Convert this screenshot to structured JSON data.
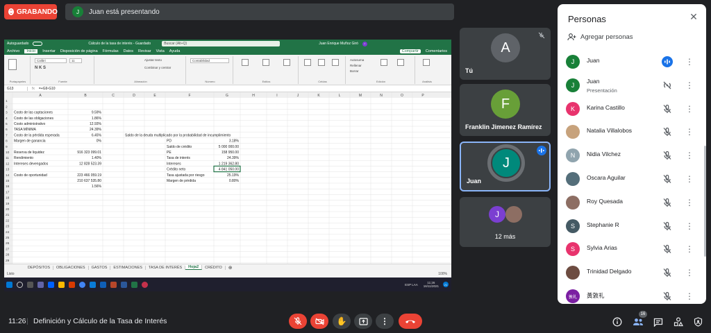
{
  "recording": {
    "label": "GRABANDO"
  },
  "presenting": {
    "initial": "J",
    "text": "Juan está presentando",
    "color": "#188038"
  },
  "excel": {
    "autosave": "Autoguardado",
    "doc_title": "Cálculo de la tasa de interés - Guardado",
    "search_placeholder": "Buscar (Alt+Q)",
    "user": "Juan Enrique Muñoz Giró",
    "menu": [
      "Archivo",
      "Inicio",
      "Insertar",
      "Disposición de página",
      "Fórmulas",
      "Datos",
      "Revisar",
      "Vista",
      "Ayuda"
    ],
    "active_menu": "Inicio",
    "share": "Compartir",
    "comments": "Comentarios",
    "ribbon_groups": [
      "Portapapeles",
      "Fuente",
      "Alineación",
      "Número",
      "Estilos",
      "Celdas",
      "Edición",
      "Análisis"
    ],
    "font": "Calibri",
    "font_size": "11",
    "number_format": "Contabilidad",
    "ribbon_labels": [
      "Ajustar texto",
      "Combinar y centrar",
      "Formato condicional",
      "Dar formato como tabla",
      "Estilos de celda",
      "Insertar",
      "Eliminar",
      "Formato",
      "Autosuma",
      "Rellenar",
      "Borrar",
      "Ordenar y filtrar",
      "Buscar y seleccionar",
      "Analizar datos"
    ],
    "name_box": "G13",
    "formula": "=+G9-G10",
    "columns": [
      "A",
      "B",
      "C",
      "D",
      "E",
      "F",
      "G",
      "H",
      "I",
      "J",
      "K",
      "L",
      "M",
      "N",
      "O",
      "P"
    ],
    "row_numbers": [
      "1",
      "2",
      "3",
      "4",
      "5",
      "6",
      "7",
      "8",
      "9",
      "10",
      "11",
      "12",
      "13",
      "14",
      "15",
      "16",
      "17",
      "18",
      "19",
      "20",
      "21",
      "22",
      "23",
      "24",
      "25",
      "26",
      "27",
      "28",
      "29"
    ],
    "left_block": [
      {
        "row": 3,
        "label": "Costo de las captaciones",
        "value": "9.59%"
      },
      {
        "row": 4,
        "label": "Costo de las obligaciones",
        "value": "1.86%"
      },
      {
        "row": 5,
        "label": "Costo administrativo",
        "value": "12.93%"
      },
      {
        "row": 6,
        "label": "TASA MÍNIMA",
        "value": "24.39%"
      },
      {
        "row": 7,
        "label": "Costo de la pérdida esperada",
        "value": "6.45%"
      },
      {
        "row": 8,
        "label": "Margen de ganancia",
        "value": "0%"
      },
      {
        "row": 10,
        "label": "Reserva de liquidez",
        "value": "916 323 099.01"
      },
      {
        "row": 11,
        "label": "Rendimiento",
        "value": "1.40%"
      },
      {
        "row": 12,
        "label": "Intereses devengados",
        "value": "12 828 523.39"
      },
      {
        "row": 14,
        "label": "Costo de oportunidad",
        "value": "223 466 059.19"
      },
      {
        "row": 15,
        "label": "",
        "value": "210 637 535.80"
      },
      {
        "row": 16,
        "label": "",
        "value": "1.56%"
      }
    ],
    "heading_text": "Saldo de la deuda multiplicado por la probabilidad de incumplimiento",
    "right_block": [
      {
        "row": 8,
        "label": "PD",
        "value": "3.18%"
      },
      {
        "row": 9,
        "label": "Saldo de crédito",
        "value": "5 000 000.00"
      },
      {
        "row": 10,
        "label": "PE",
        "value": "158 950.00"
      },
      {
        "row": 11,
        "label": "Tasa de interés",
        "value": "24.39%"
      },
      {
        "row": 12,
        "label": "Intereses",
        "value": "1 219 362.80"
      },
      {
        "row": 13,
        "label": "Crédito neto",
        "value": "4 841 050.00"
      },
      {
        "row": 14,
        "label": "Tasa ajustada por riesgo",
        "value": "25.19%"
      },
      {
        "row": 15,
        "label": "Margen de pérdida",
        "value": "0.80%"
      }
    ],
    "sheets": [
      "DEPÓSITOS",
      "OBLIGACIONES",
      "GASTOS",
      "ESTIMACIONES",
      "TASA DE INTERÉS",
      "Hoja2",
      "CRÉDITO"
    ],
    "active_sheet": "Hoja2",
    "status": "Listo",
    "zoom": "100%",
    "tray": {
      "lang": "ESP LAA",
      "time": "11:26",
      "date": "16/11/2021",
      "badge": "21"
    }
  },
  "tiles": [
    {
      "name": "Tú",
      "initial": "A",
      "color": "#5f6368"
    },
    {
      "name": "Franklin Jimenez Ramírez",
      "initial": "F",
      "color": "#689f38"
    },
    {
      "name": "Juan",
      "initial": "J",
      "color": "#00897b"
    },
    {
      "name": "12 más",
      "initial": "J",
      "color": "#7b3fd1"
    }
  ],
  "panel": {
    "title": "Personas",
    "add_people": "Agregar personas",
    "people": [
      {
        "name": "Juan",
        "sub": "",
        "initial": "J",
        "color": "#188038",
        "mic": "speaking"
      },
      {
        "name": "Juan",
        "sub": "Presentación",
        "initial": "J",
        "color": "#188038",
        "mic": "present-off"
      },
      {
        "name": "Karina Castillo",
        "sub": "",
        "initial": "K",
        "color": "#e8336d",
        "mic": "muted"
      },
      {
        "name": "Natalia Villalobos",
        "sub": "",
        "initial": "",
        "color": "#c7a27c",
        "mic": "muted"
      },
      {
        "name": "Nidia Vilchez",
        "sub": "",
        "initial": "N",
        "color": "#90a4ae",
        "mic": "muted"
      },
      {
        "name": "Oscara Aguilar",
        "sub": "",
        "initial": "",
        "color": "#546e7a",
        "mic": "muted"
      },
      {
        "name": "Roy Quesada",
        "sub": "",
        "initial": "",
        "color": "#8d6e63",
        "mic": "muted"
      },
      {
        "name": "Stephanie R",
        "sub": "",
        "initial": "S",
        "color": "#455a64",
        "mic": "muted"
      },
      {
        "name": "Sylvia Arias",
        "sub": "",
        "initial": "S",
        "color": "#e8336d",
        "mic": "muted"
      },
      {
        "name": "Trinidad Delgado",
        "sub": "",
        "initial": "",
        "color": "#6d4c41",
        "mic": "muted"
      },
      {
        "name": "黃敦礼",
        "sub": "",
        "initial": "敦礼",
        "color": "#7b1fa2",
        "mic": "muted"
      }
    ]
  },
  "bottom": {
    "time": "11:26",
    "title": "Definición y Cálculo de la Tasa de Interés",
    "participants_badge": "16"
  },
  "colors": {
    "end_call": "#ea4335",
    "excel_green": "#217346",
    "speaking": "#1a73e8"
  }
}
